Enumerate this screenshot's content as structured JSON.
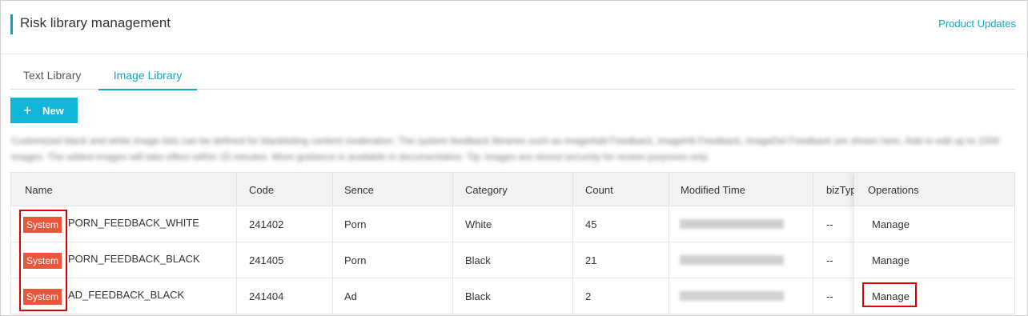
{
  "header": {
    "title": "Risk library management",
    "updates_link": "Product Updates"
  },
  "tabs": [
    {
      "label": "Text Library",
      "active": false
    },
    {
      "label": "Image Library",
      "active": true
    }
  ],
  "toolbar": {
    "new_label": "New",
    "new_icon": "plus-icon"
  },
  "description": "Customized black and white image lists can be defined for blacklisting content moderation. The system feedback libraries such as imageAdd Feedback, imageHit Feedback, imageDel Feedback are shown here. Add or edit up to 1000 images. The added images will take effect within 15 minutes. More guidance is available in documentation. Tip: images are stored securely for review purposes only.",
  "table": {
    "columns": [
      "Name",
      "Code",
      "Sence",
      "Category",
      "Count",
      "Modified Time",
      "bizTyp",
      "Operations"
    ],
    "rows": [
      {
        "badge": "System",
        "name": "PORN_FEEDBACK_WHITE",
        "code": "241402",
        "sence": "Porn",
        "category": "White",
        "count": "45",
        "biztype": "--",
        "operation": "Manage"
      },
      {
        "badge": "System",
        "name": "PORN_FEEDBACK_BLACK",
        "code": "241405",
        "sence": "Porn",
        "category": "Black",
        "count": "21",
        "biztype": "--",
        "operation": "Manage"
      },
      {
        "badge": "System",
        "name": "AD_FEEDBACK_BLACK",
        "code": "241404",
        "sence": "Ad",
        "category": "Black",
        "count": "2",
        "biztype": "--",
        "operation": "Manage"
      }
    ]
  },
  "colors": {
    "accent": "#11a8c9",
    "new_button": "#0fb6d8",
    "badge": "#e9563c",
    "highlight": "#e00000"
  }
}
